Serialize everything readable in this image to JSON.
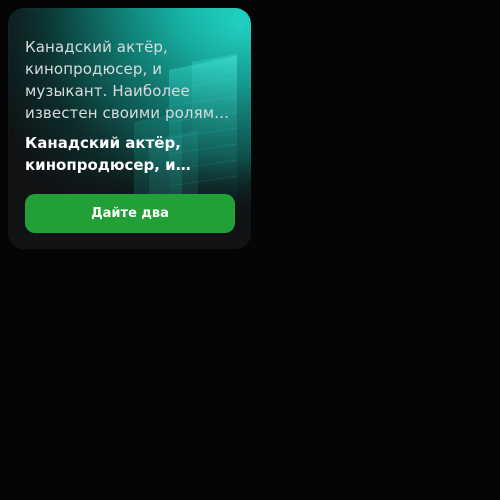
{
  "card": {
    "description": "Канадский актёр, кинопродюсер, и музыкант. Наиболее известен своими ролями в фильмах",
    "headline": "Канадский актёр, кинопродюсер, и музыкант",
    "cta_label": "Дайте два"
  },
  "colors": {
    "background": "#050506",
    "card_dark": "#111315",
    "accent_teal": "#22d7c7",
    "button_green": "#21a038",
    "text_light": "#d8dcde",
    "text_white": "#ffffff"
  }
}
